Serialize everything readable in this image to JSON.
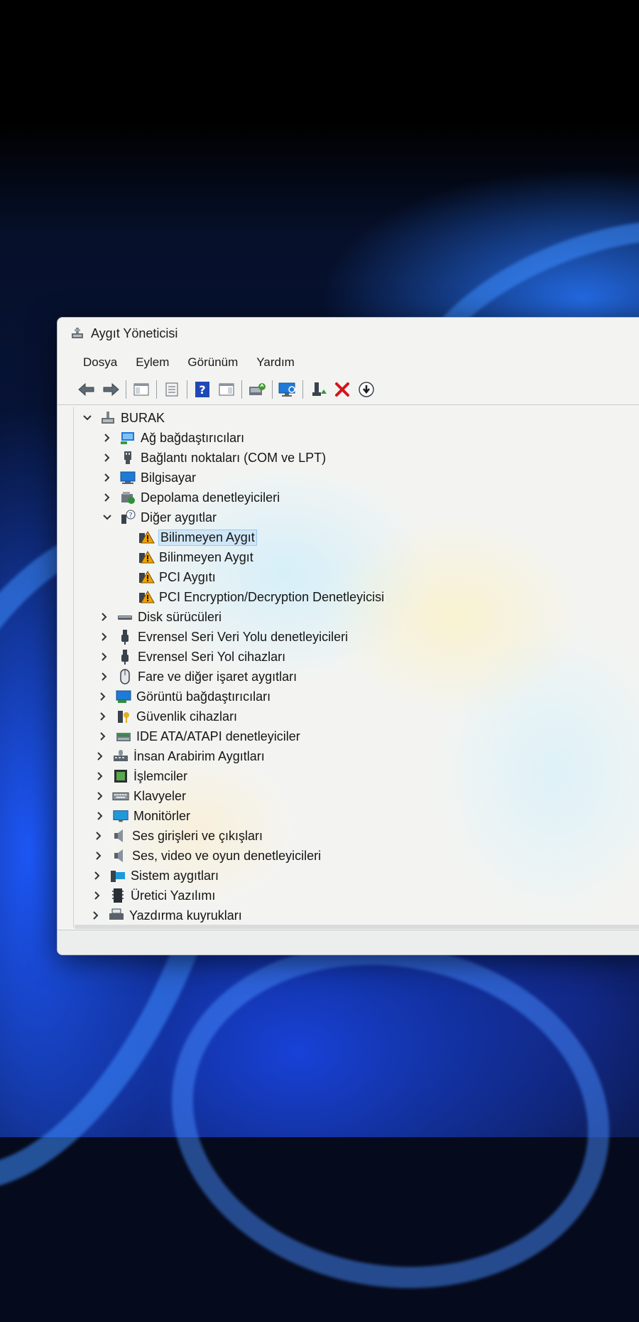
{
  "window": {
    "title": "Aygıt Yöneticisi"
  },
  "menu": [
    "Dosya",
    "Eylem",
    "Görünüm",
    "Yardım"
  ],
  "toolbar": {
    "buttons": [
      {
        "name": "back-icon",
        "icon": "arrow-left"
      },
      {
        "name": "forward-icon",
        "icon": "arrow-right"
      },
      {
        "name": "show-hide-console-tree-icon",
        "icon": "console-tree"
      },
      {
        "name": "properties-icon",
        "icon": "properties"
      },
      {
        "name": "help-icon",
        "icon": "help"
      },
      {
        "name": "show-action-pane-icon",
        "icon": "action-pane"
      },
      {
        "name": "update-driver-icon",
        "icon": "update-driver"
      },
      {
        "name": "scan-hardware-icon",
        "icon": "monitor-scan"
      },
      {
        "name": "add-legacy-hardware-icon",
        "icon": "enable-device"
      },
      {
        "name": "uninstall-device-icon",
        "icon": "red-x"
      },
      {
        "name": "disable-device-icon",
        "icon": "download-circle"
      }
    ]
  },
  "tree": {
    "root": {
      "label": "BURAK",
      "expanded": true,
      "icon": "computer-network-icon"
    },
    "categories": [
      {
        "label": "Ağ bağdaştırıcıları",
        "icon": "network-adapter-icon",
        "expanded": false
      },
      {
        "label": "Bağlantı noktaları (COM ve LPT)",
        "icon": "port-icon",
        "expanded": false
      },
      {
        "label": "Bilgisayar",
        "icon": "computer-icon",
        "expanded": false
      },
      {
        "label": "Depolama denetleyicileri",
        "icon": "storage-controller-icon",
        "expanded": false
      },
      {
        "label": "Diğer aygıtlar",
        "icon": "other-devices-icon",
        "expanded": true,
        "children": [
          {
            "label": "Bilinmeyen Aygıt",
            "icon": "warning-device-icon",
            "selected": true
          },
          {
            "label": "Bilinmeyen Aygıt",
            "icon": "warning-device-icon",
            "selected": false
          },
          {
            "label": "PCI Aygıtı",
            "icon": "warning-device-icon",
            "selected": false
          },
          {
            "label": "PCI Encryption/Decryption Denetleyicisi",
            "icon": "warning-device-icon",
            "selected": false
          }
        ]
      },
      {
        "label": "Disk sürücüleri",
        "icon": "disk-drive-icon",
        "expanded": false
      },
      {
        "label": "Evrensel Seri Veri Yolu denetleyicileri",
        "icon": "usb-icon",
        "expanded": false
      },
      {
        "label": "Evrensel Seri Yol cihazları",
        "icon": "usb-icon",
        "expanded": false
      },
      {
        "label": "Fare ve diğer işaret aygıtları",
        "icon": "mouse-icon",
        "expanded": false
      },
      {
        "label": "Görüntü bağdaştırıcıları",
        "icon": "display-adapter-icon",
        "expanded": false
      },
      {
        "label": "Güvenlik cihazları",
        "icon": "security-device-icon",
        "expanded": false
      },
      {
        "label": "IDE ATA/ATAPI denetleyiciler",
        "icon": "ide-controller-icon",
        "expanded": false
      },
      {
        "label": "İnsan Arabirim Aygıtları",
        "icon": "hid-icon",
        "expanded": false
      },
      {
        "label": "İşlemciler",
        "icon": "processor-icon",
        "expanded": false
      },
      {
        "label": "Klavyeler",
        "icon": "keyboard-icon",
        "expanded": false
      },
      {
        "label": "Monitörler",
        "icon": "monitor-icon",
        "expanded": false
      },
      {
        "label": "Ses girişleri ve çıkışları",
        "icon": "speaker-icon",
        "expanded": false
      },
      {
        "label": "Ses, video ve oyun denetleyicileri",
        "icon": "speaker-icon",
        "expanded": false
      },
      {
        "label": "Sistem aygıtları",
        "icon": "system-device-icon",
        "expanded": false
      },
      {
        "label": "Üretici Yazılımı",
        "icon": "firmware-icon",
        "expanded": false
      },
      {
        "label": "Yazdırma kuyrukları",
        "icon": "print-queue-icon",
        "expanded": false
      }
    ]
  },
  "colors": {
    "selection": "#cfe6f7",
    "warning": "#f2a200",
    "accent_blue": "#1f7ad8",
    "uninstall_red": "#d4141c"
  }
}
